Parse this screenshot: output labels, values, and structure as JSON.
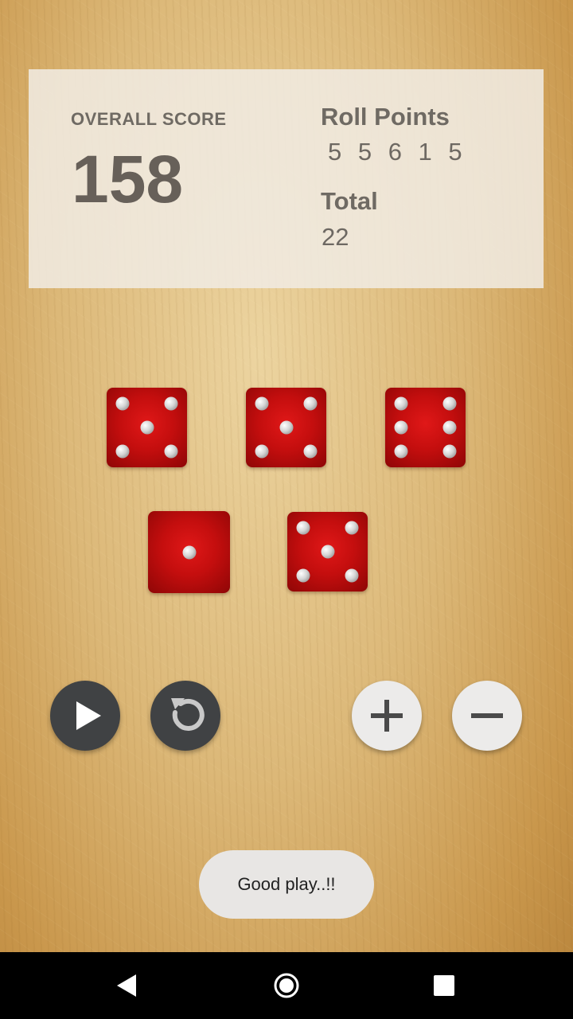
{
  "score": {
    "overall_label": "OVERALL SCORE",
    "overall_value": "158",
    "roll_label": "Roll Points",
    "roll_values": "5 5 6 1 5",
    "total_label": "Total",
    "total_value": "22"
  },
  "dice": [
    5,
    5,
    6,
    1,
    5
  ],
  "controls": {
    "play": "play-icon",
    "reset": "replay-icon",
    "add": "plus-icon",
    "remove": "minus-icon"
  },
  "toast": {
    "message": "Good play..!!"
  },
  "navbar": {
    "back": "back-triangle-icon",
    "home": "home-circle-icon",
    "recents": "recents-square-icon"
  },
  "colors": {
    "die_red": "#c40e0e",
    "pip_silver": "#d4d4d4",
    "panel": "#f0ebe1",
    "dark_button": "#404244",
    "light_button": "#ecebea"
  }
}
